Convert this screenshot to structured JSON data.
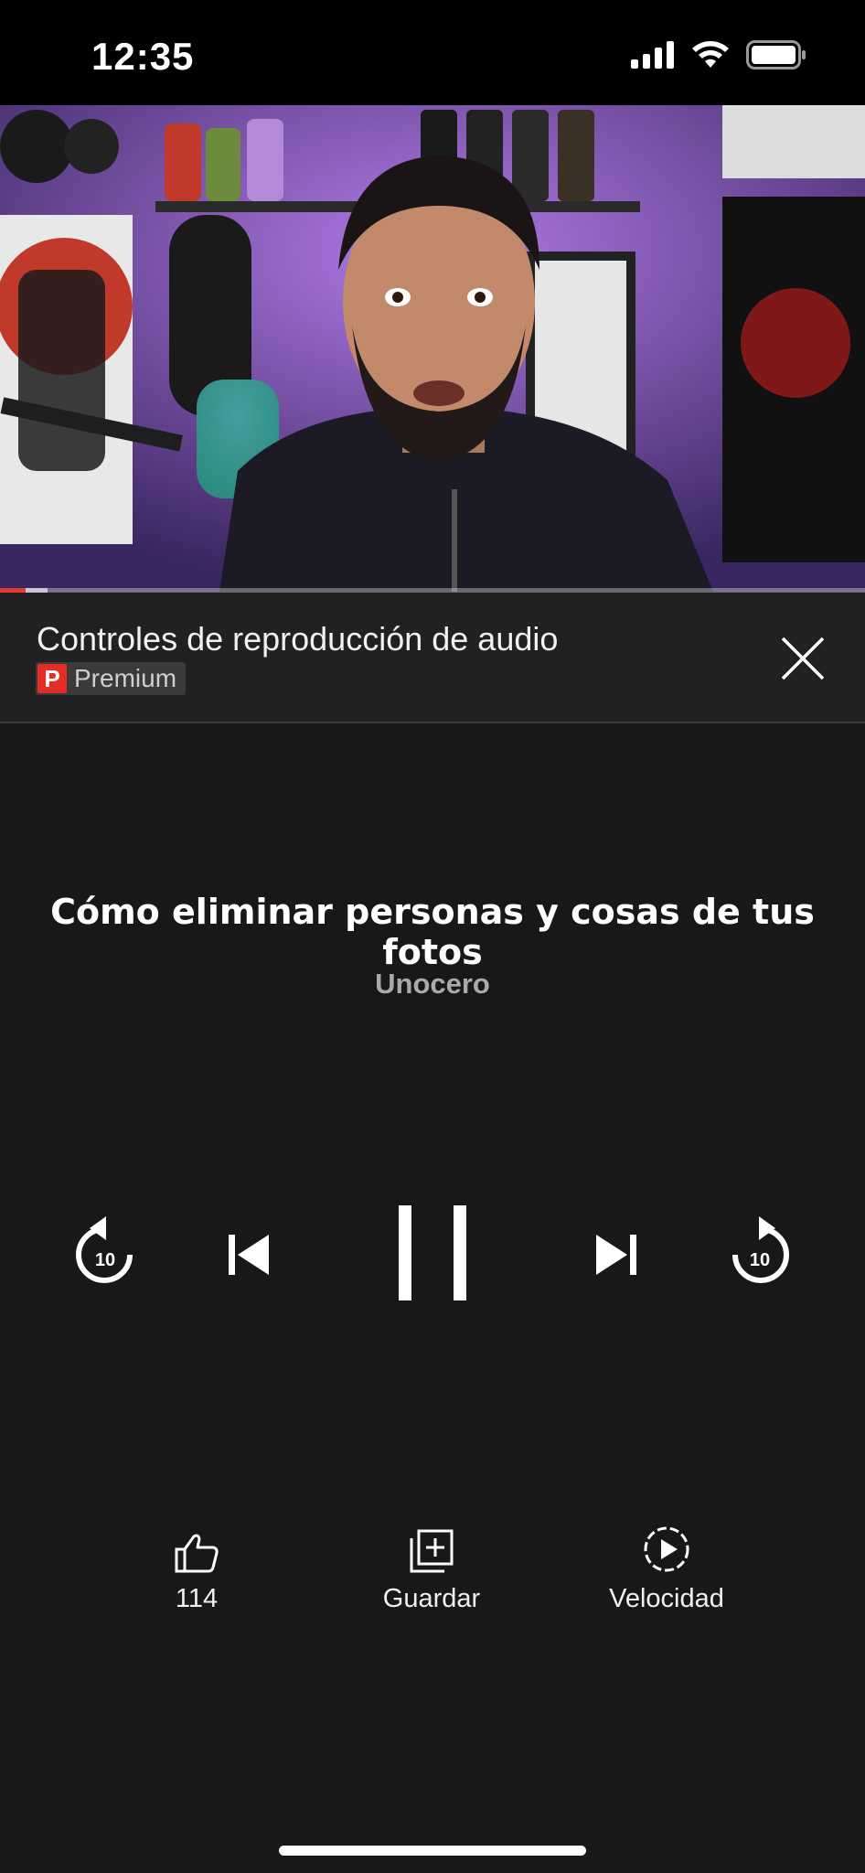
{
  "status_bar": {
    "time": "12:35",
    "icons": [
      "signal-icon",
      "wifi-icon",
      "battery-icon"
    ]
  },
  "video": {
    "progress_fraction": 0.03,
    "buffer_fraction": 0.055
  },
  "header": {
    "title": "Controles de reproducción de audio",
    "badge_letter": "P",
    "badge_label": "Premium",
    "close_icon": "close-icon"
  },
  "track": {
    "title": "Cómo eliminar personas y cosas de tus fotos",
    "channel": "Unocero"
  },
  "controls": {
    "replay_seconds": "10",
    "forward_seconds": "10",
    "buttons": [
      "replay-10-icon",
      "previous-icon",
      "pause-icon",
      "next-icon",
      "forward-10-icon"
    ]
  },
  "actions": {
    "like_count": "114",
    "save_label": "Guardar",
    "speed_label": "Velocidad"
  },
  "colors": {
    "background": "#181818",
    "header_background": "#212121",
    "accent_red": "#e52d27",
    "secondary_text": "#aaaaaa"
  }
}
